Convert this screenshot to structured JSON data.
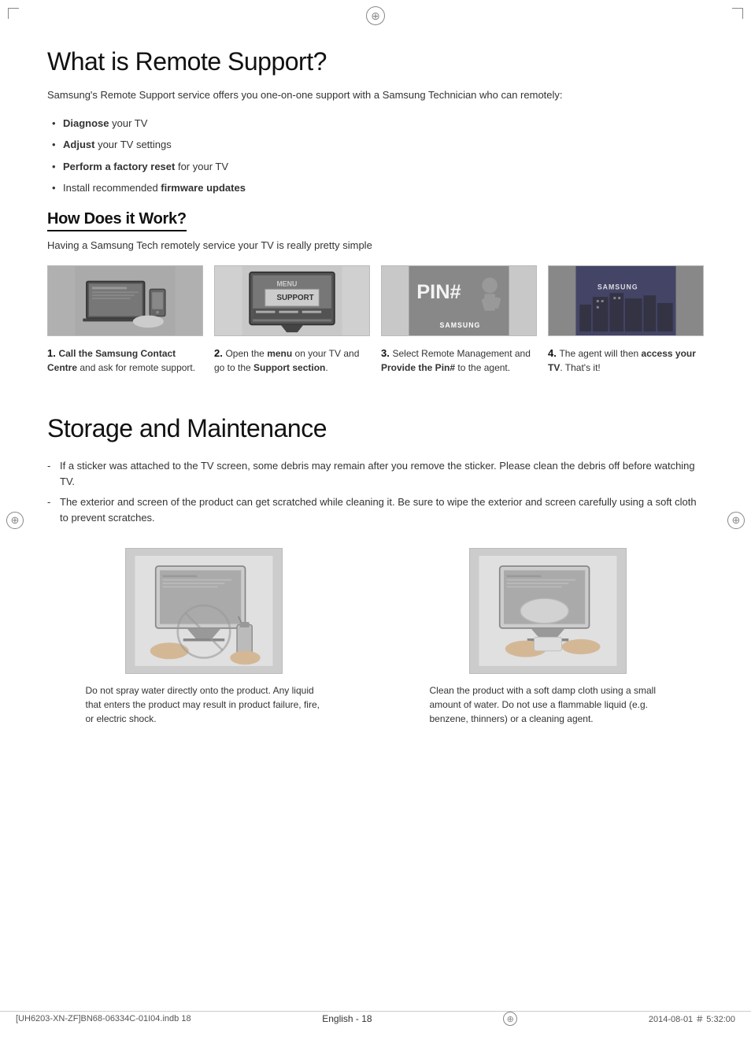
{
  "page": {
    "top_compass": "⊕",
    "left_compass": "⊕",
    "right_compass": "⊕",
    "footer_compass": "⊕"
  },
  "remote_support": {
    "title": "What is Remote Support?",
    "intro": "Samsung's Remote Support service offers you one-on-one support with a Samsung Technician who can remotely:",
    "bullets": [
      {
        "text": " your TV",
        "bold": "Diagnose"
      },
      {
        "text": " your TV settings",
        "bold": "Adjust"
      },
      {
        "text": " for your TV",
        "bold": "Perform a factory reset"
      },
      {
        "text": "Install recommended ",
        "bold": "firmware updates",
        "after": ""
      }
    ],
    "how_title": "How Does it Work?",
    "how_subtitle": "Having a Samsung Tech remotely service your TV is really pretty simple",
    "steps": [
      {
        "number": "1.",
        "desc_parts": [
          {
            "bold": "Call the Samsung Contact Centre",
            "text": " and ask for remote support."
          }
        ]
      },
      {
        "number": "2.",
        "desc_parts": [
          {
            "text": "Open the "
          },
          {
            "bold": "menu"
          },
          {
            "text": " on your TV and go to the "
          },
          {
            "bold": "Support section"
          },
          {
            "text": "."
          }
        ]
      },
      {
        "number": "3.",
        "desc_parts": [
          {
            "text": "Select Remote Management and "
          },
          {
            "bold": "Provide the Pin#"
          },
          {
            "text": " to the agent."
          }
        ]
      },
      {
        "number": "4.",
        "desc_parts": [
          {
            "text": "The agent will then "
          },
          {
            "bold": "access your TV"
          },
          {
            "text": ". That's it!"
          }
        ]
      }
    ]
  },
  "storage": {
    "title": "Storage and Maintenance",
    "bullets": [
      "If a sticker was attached to the TV screen, some debris may remain after you remove the sticker. Please clean the debris off before watching TV.",
      "The exterior and screen of the product can get scratched while cleaning it. Be sure to wipe the exterior and screen carefully using a soft cloth to prevent scratches."
    ],
    "captions": [
      "Do not spray water directly onto the product. Any liquid that enters the product may result in product failure, fire, or electric shock.",
      "Clean the product with a soft damp cloth using a small amount of water. Do not use a flammable liquid (e.g. benzene, thinners) or a cleaning agent."
    ]
  },
  "footer": {
    "left": "[UH6203-XN-ZF]BN68-06334C-01I04.indb   18",
    "center": "English - 18",
    "right": "2014-08-01   ＃ 5:32:00"
  }
}
